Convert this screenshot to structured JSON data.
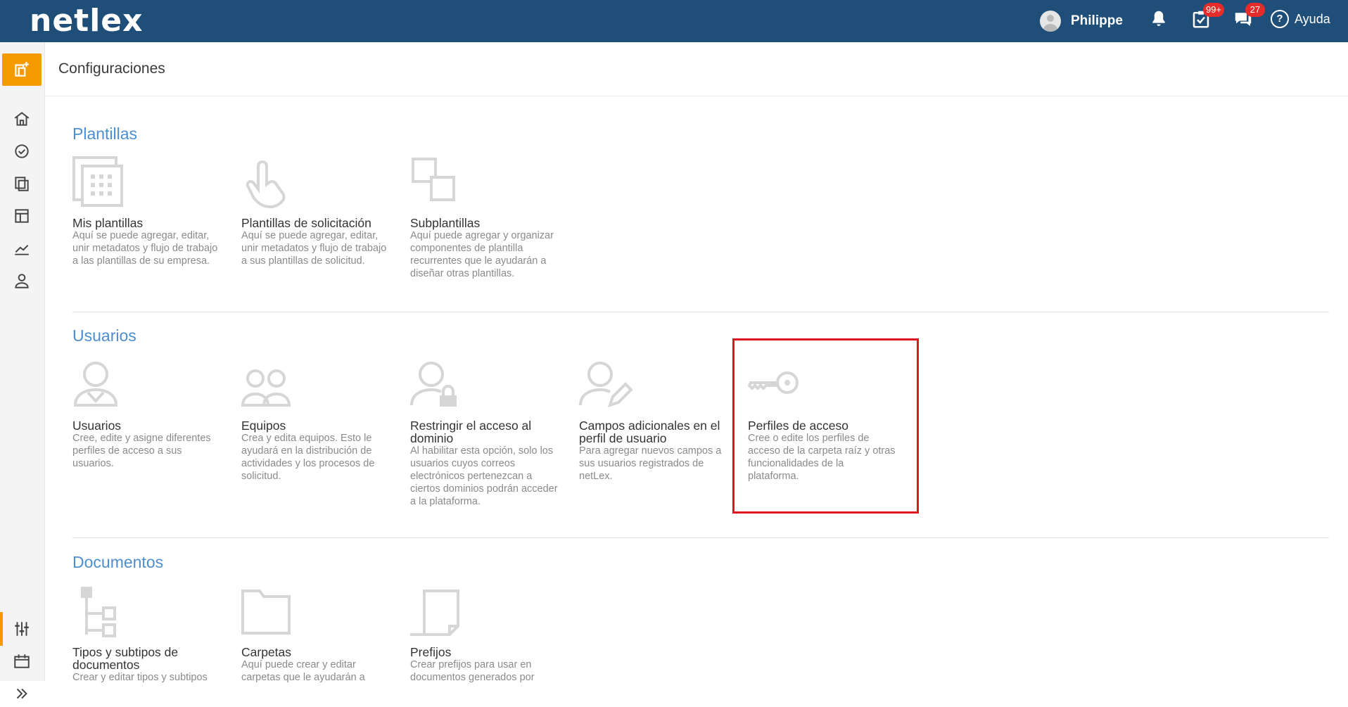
{
  "header": {
    "logo": "netlex",
    "user_name": "Philippe",
    "tasks_badge": "99+",
    "messages_badge": "27",
    "help_label": "Ayuda"
  },
  "page": {
    "title": "Configuraciones"
  },
  "sections": [
    {
      "title": "Plantillas",
      "cards": [
        {
          "title": "Mis plantillas",
          "desc": "Aquí se puede agregar, editar, unir metadatos y flujo de trabajo a las plantillas de su empresa.",
          "icon": "template-grid-icon"
        },
        {
          "title": "Plantillas de solicitación",
          "desc": "Aquí se puede agregar, editar, unir metadatos y flujo de trabajo a sus plantillas de solicitud.",
          "icon": "hand-pointer-icon"
        },
        {
          "title": "Subplantillas",
          "desc": "Aquí puede agregar y organizar componentes de plantilla recurrentes que le ayudarán a diseñar otras plantillas.",
          "icon": "subtemplate-squares-icon"
        }
      ]
    },
    {
      "title": "Usuarios",
      "cards": [
        {
          "title": "Usuarios",
          "desc": "Cree, edite y asigne diferentes perfiles de acceso a sus usuarios.",
          "icon": "user-icon"
        },
        {
          "title": "Equipos",
          "desc": "Crea y edita equipos. Esto le ayudará en la distribución de actividades y los procesos de solicitud.",
          "icon": "team-icon"
        },
        {
          "title": "Restringir el acceso al dominio",
          "desc": "Al habilitar esta opción, solo los usuarios cuyos correos electrónicos pertenezcan a ciertos dominios podrán acceder a la plataforma.",
          "icon": "user-lock-icon"
        },
        {
          "title": "Campos adicionales en el perfil de usuario",
          "desc": "Para agregar nuevos campos a sus usuarios registrados de netLex.",
          "icon": "user-edit-icon"
        },
        {
          "title": "Perfiles de acceso",
          "desc": "Cree o edite los perfiles de acceso de la carpeta raíz y otras funcionalidades de la plataforma.",
          "icon": "key-icon"
        }
      ]
    },
    {
      "title": "Documentos",
      "cards": [
        {
          "title": "Tipos y subtipos de documentos",
          "desc": "Crear y editar tipos y subtipos",
          "icon": "hierarchy-icon"
        },
        {
          "title": "Carpetas",
          "desc": "Aquí puede crear y editar carpetas que le ayudarán a",
          "icon": "folder-icon"
        },
        {
          "title": "Prefijos",
          "desc": "Crear prefijos para usar en documentos generados por",
          "icon": "document-prefix-icon"
        }
      ]
    }
  ]
}
